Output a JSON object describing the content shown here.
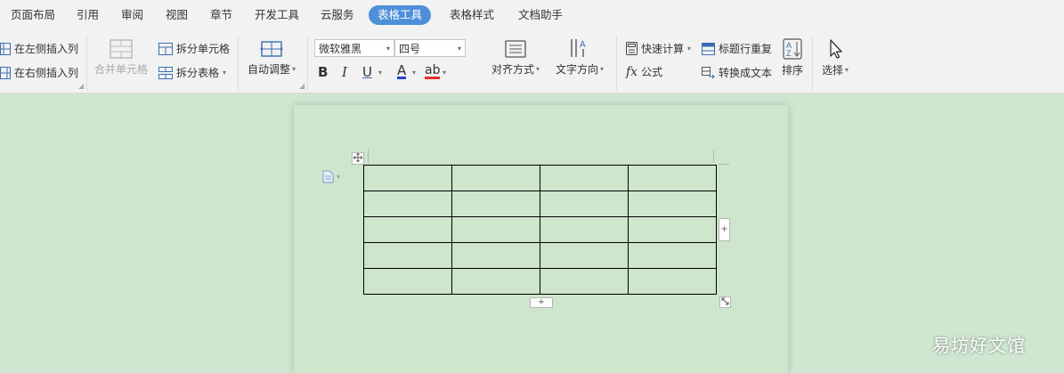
{
  "menu": {
    "tabs": [
      "页面布局",
      "引用",
      "审阅",
      "视图",
      "章节",
      "开发工具",
      "云服务",
      "表格工具",
      "表格样式",
      "文档助手"
    ],
    "active_tab": "表格工具"
  },
  "ribbon": {
    "insert_left": "在左侧插入列",
    "insert_right": "在右侧插入列",
    "merge_cells": "合并单元格",
    "split_cells": "拆分单元格",
    "split_table": "拆分表格",
    "auto_fit": "自动调整",
    "font_name": "微软雅黑",
    "font_size": "四号",
    "bold": "B",
    "italic": "I",
    "underline": "U",
    "font_color": "A",
    "highlight": "ab",
    "align": "对齐方式",
    "text_direction": "文字方向",
    "quick_calc": "快速计算",
    "formula_fx": "fx",
    "formula": "公式",
    "repeat_header": "标题行重复",
    "convert_text": "转换成文本",
    "sort": "排序",
    "select": "选择"
  },
  "document": {
    "table_rows": 5,
    "table_cols": 4,
    "add_symbol": "+"
  },
  "watermark": "易坊好文馆",
  "colors": {
    "active_tab": "#4e8fd9",
    "workspace": "#cfe6d1",
    "page": "#cde6cc",
    "font_color_bar": "#2244cc",
    "highlight_bar": "#e03030"
  }
}
